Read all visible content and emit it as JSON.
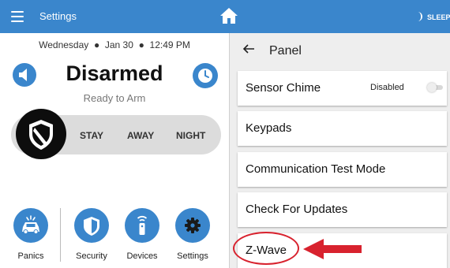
{
  "topbar": {
    "title": "Settings",
    "sleep_label": "SLEEP",
    "icons": [
      "menu-icon",
      "home-icon",
      "moon-icon"
    ],
    "color": "#3a86cc"
  },
  "status_panel": {
    "date": "Wednesday",
    "day": "Jan 30",
    "time": "12:49 PM",
    "status": "Disarmed",
    "substatus": "Ready to Arm",
    "arm_options": [
      "STAY",
      "AWAY",
      "NIGHT"
    ],
    "icons": [
      "speaker-icon",
      "clock-icon",
      "shield-icon"
    ]
  },
  "bottom_nav": [
    {
      "label": "Panics",
      "icon": "police-car-icon"
    },
    {
      "label": "Security",
      "icon": "shield-icon"
    },
    {
      "label": "Devices",
      "icon": "remote-icon"
    },
    {
      "label": "Settings",
      "icon": "gear-icon"
    }
  ],
  "panel": {
    "title": "Panel",
    "items": [
      {
        "label": "Sensor Chime",
        "value": "Disabled",
        "toggle": false
      },
      {
        "label": "Keypads"
      },
      {
        "label": "Communication Test Mode"
      },
      {
        "label": "Check For Updates"
      },
      {
        "label": "Z-Wave"
      }
    ]
  },
  "annotation": {
    "color": "#d8222e",
    "target": "Z-Wave"
  }
}
